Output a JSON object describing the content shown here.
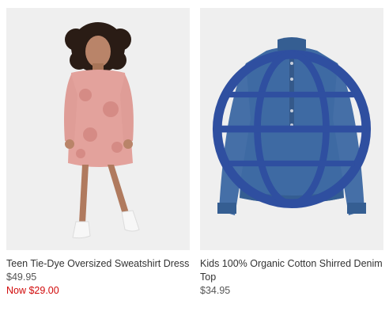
{
  "products": [
    {
      "name": "Teen Tie-Dye Oversized Sweatshirt Dress",
      "price": "$49.95",
      "sale_price": "Now $29.00",
      "image_icon": "model-in-pink-sweatshirt-dress"
    },
    {
      "name": "Kids 100% Organic Cotton Shirred Denim Top",
      "price": "$34.95",
      "image_icon": "denim-top",
      "badge_icon": "globe-icon"
    }
  ],
  "colors": {
    "sale": "#d10a0a",
    "image_background": "#efefef",
    "denim": "#3e6aa3"
  }
}
